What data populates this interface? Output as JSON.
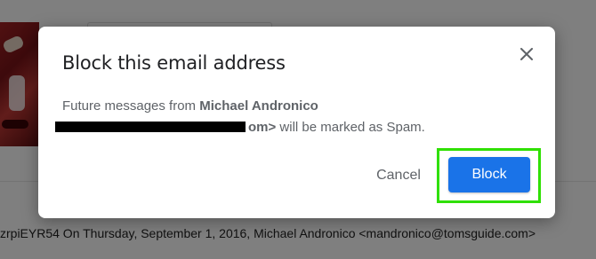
{
  "background": {
    "quote_line": "zrpiEYR54 On Thursday, September 1, 2016, Michael Andronico <mandronico@tomsguide.com>"
  },
  "dialog": {
    "title": "Block this email address",
    "body_prefix": "Future messages from ",
    "sender_name": "Michael Andronico",
    "address_tail": "om>",
    "body_suffix": " will be marked as Spam.",
    "cancel_label": "Cancel",
    "block_label": "Block"
  },
  "colors": {
    "primary_button": "#1a73e8",
    "highlight_box": "#2fe000",
    "redaction": "#000000"
  },
  "icons": {
    "close": "close-icon"
  }
}
